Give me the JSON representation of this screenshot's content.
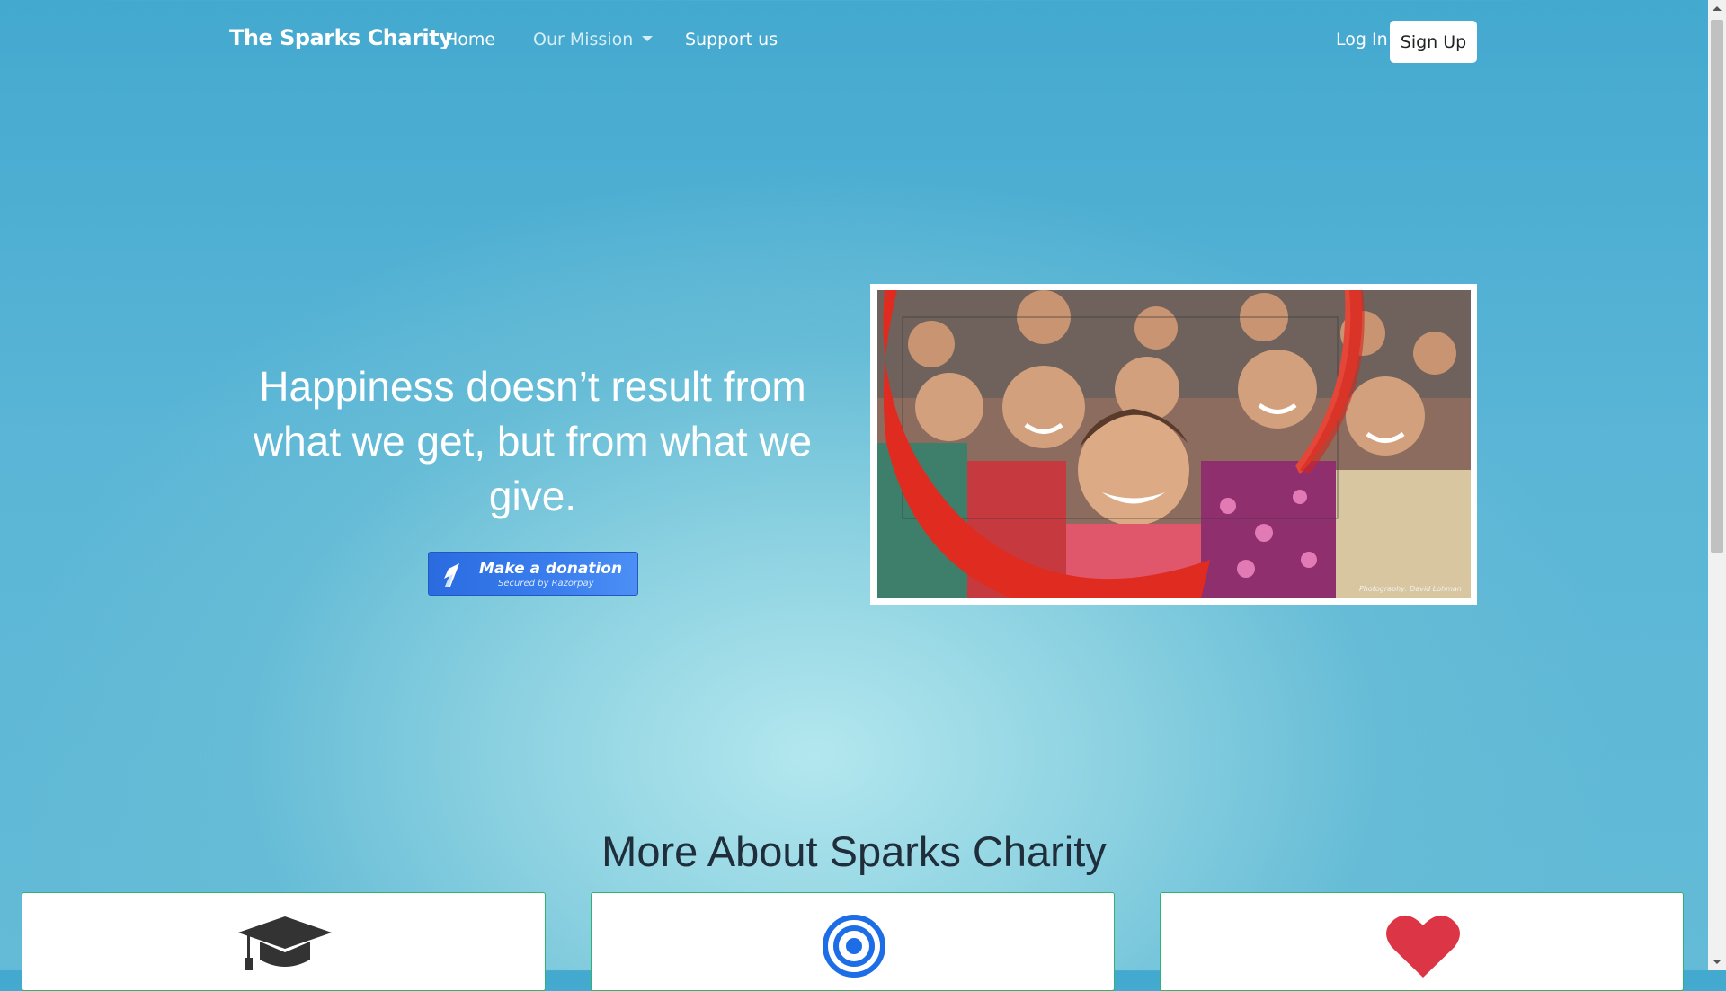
{
  "navbar": {
    "brand": "The Sparks Charity",
    "links": [
      {
        "label": "Home"
      },
      {
        "label": "Our Mission"
      },
      {
        "label": "Support us"
      }
    ],
    "login": "Log In",
    "signup": "Sign Up"
  },
  "hero": {
    "quote": "Happiness doesn’t result from what we get, but from what we give.",
    "donate_button": {
      "title": "Make a donation",
      "subtitle": "Secured by Razorpay",
      "color": "#3478ea"
    },
    "image": {
      "credit": "Photography: David Lohman",
      "accent_color": "#e02b20"
    }
  },
  "section": {
    "title": "More About Sparks Charity",
    "cards": [
      {
        "icon": "graduation-cap-icon"
      },
      {
        "icon": "target-icon"
      },
      {
        "icon": "heart-icon"
      }
    ]
  }
}
